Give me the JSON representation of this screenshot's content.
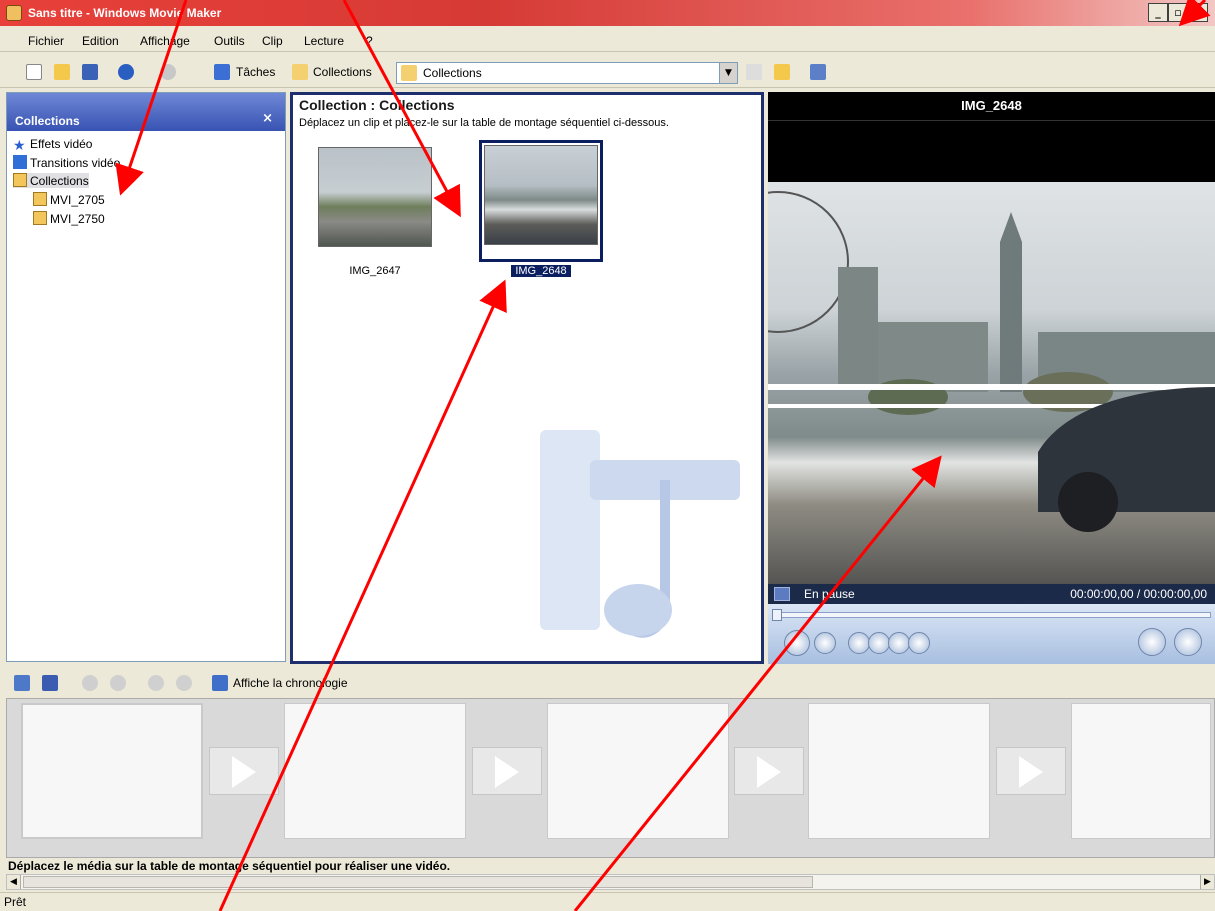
{
  "window": {
    "title": "Sans titre - Windows Movie Maker"
  },
  "menu": [
    "Fichier",
    "Edition",
    "Affichage",
    "Outils",
    "Clip",
    "Lecture",
    "?"
  ],
  "toolbar": {
    "tasks_label": "Tâches",
    "collections_label": "Collections",
    "combo_value": "Collections"
  },
  "left_panel": {
    "title": "Collections",
    "items": [
      {
        "label": "Effets vidéo"
      },
      {
        "label": "Transitions vidéo"
      },
      {
        "label": "Collections"
      },
      {
        "label": "MVI_2705"
      },
      {
        "label": "MVI_2750"
      }
    ]
  },
  "center": {
    "title": "Collection : Collections",
    "subtitle": "Déplacez un clip et placez-le sur la table de montage séquentiel ci-dessous.",
    "clips": [
      {
        "label": "IMG_2647"
      },
      {
        "label": "IMG_2648"
      }
    ]
  },
  "preview": {
    "title": "IMG_2648",
    "status": "En pause",
    "time": "00:00:00,00 / 00:00:00,00"
  },
  "storyboard": {
    "toggle_label": "Affiche la chronologie",
    "message": "Déplacez le média sur la table de montage séquentiel pour réaliser une vidéo."
  },
  "statusbar": {
    "text": "Prêt"
  },
  "colors": {
    "annotation": "#ff0000",
    "selection": "#0b1f60",
    "titlebar": "#e8403a"
  }
}
